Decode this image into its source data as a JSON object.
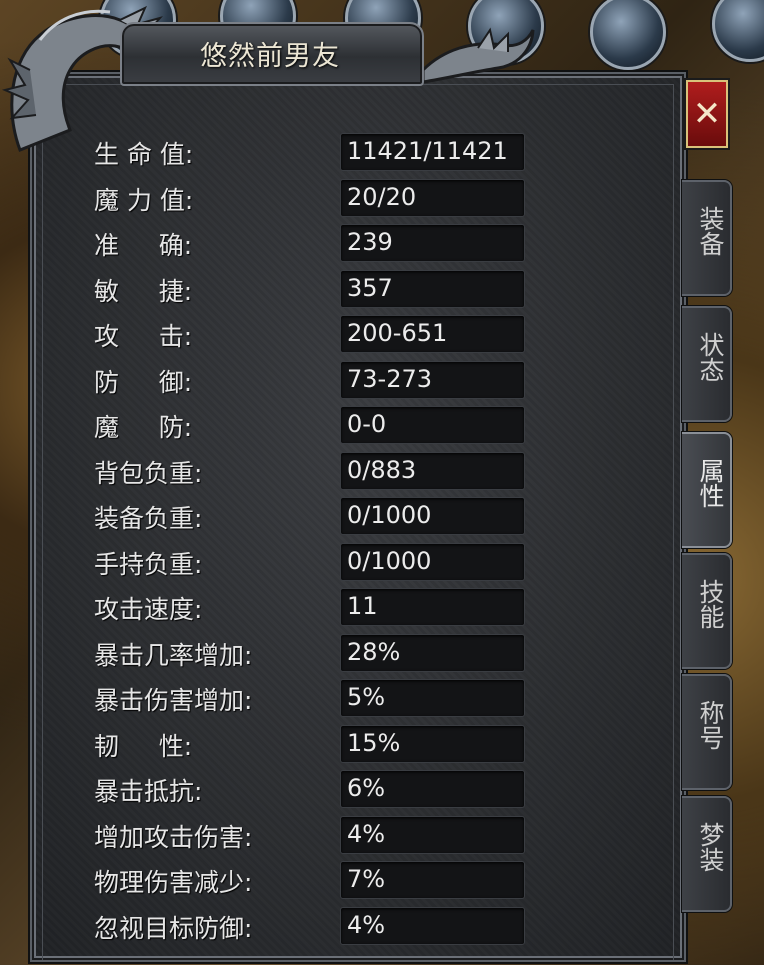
{
  "window": {
    "title": "悠然前男友",
    "close_label": "✕"
  },
  "tabs": [
    {
      "label": "装备",
      "active": false
    },
    {
      "label": "状态",
      "active": false
    },
    {
      "label": "属性",
      "active": true
    },
    {
      "label": "技能",
      "active": false
    },
    {
      "label": "称号",
      "active": false
    },
    {
      "label": "梦装",
      "active": false
    }
  ],
  "stats": [
    {
      "label": "生 命 值:",
      "value": "11421/11421"
    },
    {
      "label": "魔 力 值:",
      "value": "20/20"
    },
    {
      "label": "准     确:",
      "value": "239"
    },
    {
      "label": "敏     捷:",
      "value": "357"
    },
    {
      "label": "攻     击:",
      "value": "200-651"
    },
    {
      "label": "防     御:",
      "value": "73-273"
    },
    {
      "label": "魔     防:",
      "value": "0-0"
    },
    {
      "label": "背包负重:",
      "value": "0/883"
    },
    {
      "label": "装备负重:",
      "value": "0/1000"
    },
    {
      "label": "手持负重:",
      "value": "0/1000"
    },
    {
      "label": "攻击速度:",
      "value": "11"
    },
    {
      "label": "暴击几率增加:",
      "value": "28%"
    },
    {
      "label": "暴击伤害增加:",
      "value": "5%"
    },
    {
      "label": "韧     性:",
      "value": "15%"
    },
    {
      "label": "暴击抵抗:",
      "value": "6%"
    },
    {
      "label": "增加攻击伤害:",
      "value": "4%"
    },
    {
      "label": "物理伤害减少:",
      "value": "7%"
    },
    {
      "label": "忽视目标防御:",
      "value": "4%"
    }
  ],
  "colors": {
    "panel_bg": "#2a2c2f",
    "close_red": "#b01d1d",
    "label_text": "#e6e6e6"
  },
  "icons": [
    "dragon-ornament-icon",
    "close-icon"
  ]
}
